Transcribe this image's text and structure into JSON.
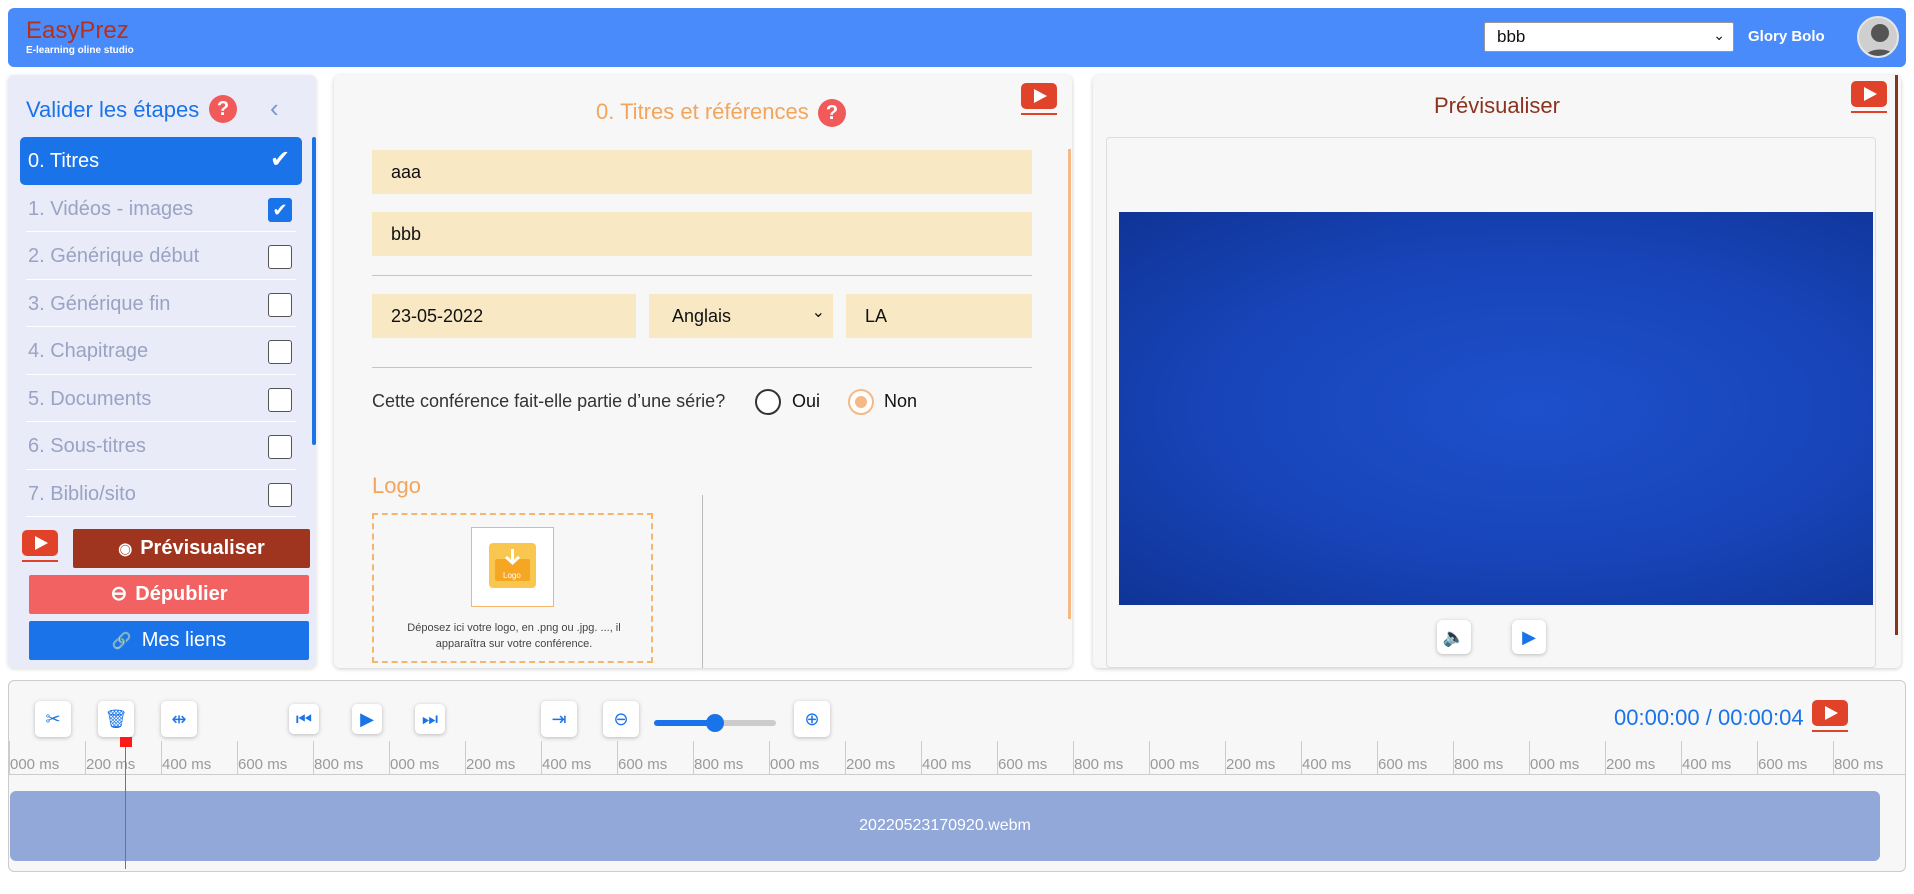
{
  "header": {
    "brand": "EasyPrez",
    "brand_sub": "E-learning oline studio",
    "project_select": "bbb",
    "user_name": "Glory Bolo"
  },
  "sidebar": {
    "title": "Valider les étapes",
    "steps": [
      {
        "label": "0. Titres",
        "state": "active"
      },
      {
        "label": "1. Vidéos - images",
        "state": "checked"
      },
      {
        "label": "2. Générique début",
        "state": "unchecked"
      },
      {
        "label": "3. Générique fin",
        "state": "unchecked"
      },
      {
        "label": "4. Chapitrage",
        "state": "unchecked"
      },
      {
        "label": "5. Documents",
        "state": "unchecked"
      },
      {
        "label": "6. Sous-titres",
        "state": "unchecked"
      },
      {
        "label": "7. Biblio/sito",
        "state": "unchecked"
      }
    ],
    "preview_label": "Prévisualiser",
    "unpublish_label": "Dépublier",
    "links_label": "Mes liens"
  },
  "form": {
    "title": "0. Titres et références",
    "title_value": "aaa",
    "subtitle_value": "bbb",
    "date_value": "23-05-2022",
    "language_value": "Anglais",
    "code_value": "LA",
    "series_question": "Cette conférence fait-elle partie d’une série?",
    "option_yes": "Oui",
    "option_no": "Non",
    "selected_option": "Non",
    "logo_title": "Logo",
    "logo_icon_text": "Logo",
    "drop_text": "Déposez ici votre logo, en .png ou .jpg. ..., il apparaîtra sur votre conférence."
  },
  "preview": {
    "title": "Prévisualiser"
  },
  "timeline": {
    "time_display": "00:00:00 / 00:00:04",
    "zoom_level": 0.5,
    "ticks": [
      "000 ms",
      "200 ms",
      "400 ms",
      "600 ms",
      "800 ms",
      "000 ms",
      "200 ms",
      "400 ms",
      "600 ms",
      "800 ms",
      "000 ms",
      "200 ms",
      "400 ms",
      "600 ms",
      "800 ms",
      "000 ms",
      "200 ms",
      "400 ms",
      "600 ms",
      "800 ms",
      "000 ms",
      "200 ms",
      "400 ms",
      "600 ms",
      "800 ms"
    ],
    "clip_name": "20220523170920.webm"
  },
  "colors": {
    "header_bg": "#4a8bfc",
    "accent_blue": "#1a73e8",
    "brand_red": "#b1321c",
    "form_orange": "#f5a55a",
    "field_bg": "#f8e8c4"
  }
}
